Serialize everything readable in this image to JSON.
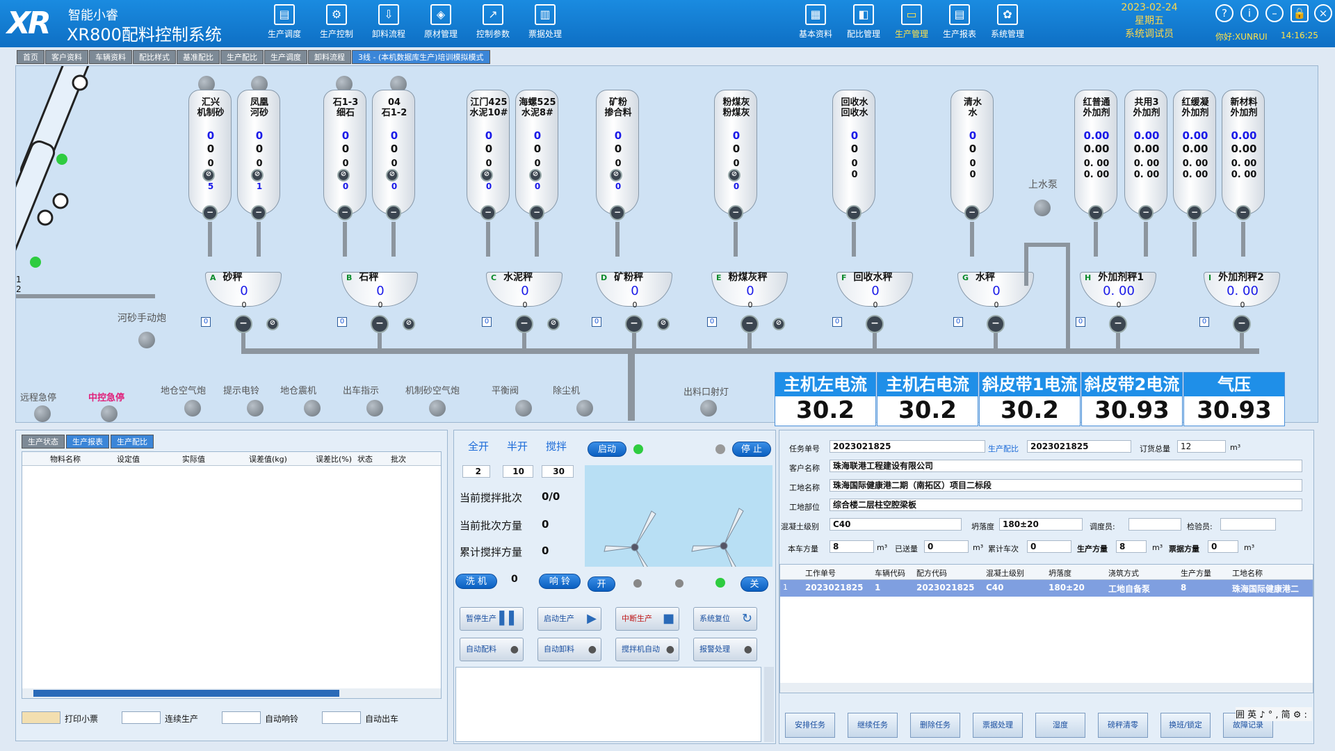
{
  "app": {
    "brand_cn": "智能小睿",
    "system_name": "XR800配料控制系统"
  },
  "topnav_left": [
    {
      "label": "生产调度",
      "icon": "schedule-icon"
    },
    {
      "label": "生产控制",
      "icon": "control-icon"
    },
    {
      "label": "卸料流程",
      "icon": "unload-icon"
    },
    {
      "label": "原材管理",
      "icon": "material-icon"
    },
    {
      "label": "控制参数",
      "icon": "chart-icon"
    },
    {
      "label": "票据处理",
      "icon": "ticket-icon"
    }
  ],
  "topnav_right": [
    {
      "label": "基本资料",
      "icon": "profile-icon"
    },
    {
      "label": "配比管理",
      "icon": "ratio-icon"
    },
    {
      "label": "生产管理",
      "icon": "monitor-icon",
      "active": true
    },
    {
      "label": "生产报表",
      "icon": "report-icon"
    },
    {
      "label": "系统管理",
      "icon": "gear-icon"
    }
  ],
  "date": "2023-02-24",
  "weekday": "星期五",
  "role": "系统调试员",
  "user": "你好:XUNRUI",
  "time": "14:16:25",
  "tabs": [
    "首页",
    "客户资料",
    "车辆资料",
    "配比样式",
    "基准配比",
    "生产配比",
    "生产调度",
    "卸料流程",
    "3线 - (本机数据库生产)培训模拟模式"
  ],
  "silos": [
    {
      "name": "汇兴\n机制砂",
      "v1": "0",
      "v2": "0",
      "v3": "0",
      "v4": "0",
      "v5": "5"
    },
    {
      "name": "凤凰\n河砂",
      "v1": "0",
      "v2": "0",
      "v3": "0",
      "v4": "0",
      "v5": "1"
    },
    {
      "name": "石1-3\n细石",
      "v1": "0",
      "v2": "0",
      "v3": "0",
      "v4": "0",
      "v5": "0"
    },
    {
      "name": "04\n石1-2",
      "v1": "0",
      "v2": "0",
      "v3": "0",
      "v4": "0",
      "v5": "0"
    },
    {
      "name": "江门425\n水泥10#",
      "v1": "0",
      "v2": "0",
      "v3": "0",
      "v4": "0",
      "v5": "0"
    },
    {
      "name": "海螺525\n水泥8#",
      "v1": "0",
      "v2": "0",
      "v3": "0",
      "v4": "0",
      "v5": "0"
    },
    {
      "name": "矿粉\n掺合料",
      "v1": "0",
      "v2": "0",
      "v3": "0",
      "v4": "0",
      "v5": "0"
    },
    {
      "name": "粉煤灰\n粉煤灰",
      "v1": "0",
      "v2": "0",
      "v3": "0",
      "v4": "0",
      "v5": "0"
    },
    {
      "name": "回收水\n回收水",
      "v1": "0",
      "v2": "0",
      "v3": "0",
      "v4": "0",
      "v5": ""
    },
    {
      "name": "清水\n水",
      "v1": "0",
      "v2": "0",
      "v3": "0",
      "v4": "0",
      "v5": ""
    },
    {
      "name": "红普通\n外加剂",
      "v1": "0.00",
      "v2": "0.00",
      "v3": "0. 00",
      "v4": "0. 00",
      "v5": ""
    },
    {
      "name": "共用3\n外加剂",
      "v1": "0.00",
      "v2": "0.00",
      "v3": "0. 00",
      "v4": "0. 00",
      "v5": ""
    },
    {
      "name": "红缓凝\n外加剂",
      "v1": "0.00",
      "v2": "0.00",
      "v3": "0. 00",
      "v4": "0. 00",
      "v5": ""
    },
    {
      "name": "新材料\n外加剂",
      "v1": "0.00",
      "v2": "0.00",
      "v3": "0. 00",
      "v4": "0. 00",
      "v5": ""
    }
  ],
  "hoppers": [
    {
      "letter": "A",
      "name": "砂秤",
      "value": "0",
      "sub": "0",
      "side": "0"
    },
    {
      "letter": "B",
      "name": "石秤",
      "value": "0",
      "sub": "0",
      "side": "0"
    },
    {
      "letter": "C",
      "name": "水泥秤",
      "value": "0",
      "sub": "0",
      "side": "0"
    },
    {
      "letter": "D",
      "name": "矿粉秤",
      "value": "0",
      "sub": "0",
      "side": "0"
    },
    {
      "letter": "E",
      "name": "粉煤灰秤",
      "value": "0",
      "sub": "0",
      "side": "0"
    },
    {
      "letter": "F",
      "name": "回收水秤",
      "value": "0",
      "sub": "0",
      "side": "0"
    },
    {
      "letter": "G",
      "name": "水秤",
      "value": "0",
      "sub": "0",
      "side": "0"
    },
    {
      "letter": "H",
      "name": "外加剂秤1",
      "value": "0. 00",
      "sub": "0",
      "side": "0"
    },
    {
      "letter": "I",
      "name": "外加剂秤2",
      "value": "0. 00",
      "sub": "0",
      "side": "0"
    }
  ],
  "conveyor": {
    "belt1": "1",
    "belt2": "2"
  },
  "labels": {
    "river_sand_cannon": "河砂手动炮",
    "water_pump": "上水泵",
    "remote_estop": "远程急停",
    "central_estop": "中控急停",
    "outlet_light": "出料口射灯"
  },
  "indicators": [
    "地仓空气炮",
    "提示电铃",
    "地仓震机",
    "出车指示",
    "机制砂空气炮",
    "平衡阀",
    "除尘机"
  ],
  "meters": [
    {
      "title": "主机左电流",
      "value": "30.2"
    },
    {
      "title": "主机右电流",
      "value": "30.2"
    },
    {
      "title": "斜皮带1电流",
      "value": "30.2"
    },
    {
      "title": "斜皮带2电流",
      "value": "30.93"
    },
    {
      "title": "气压",
      "value": "30.93"
    }
  ],
  "left_panel": {
    "tabs": [
      "生产状态",
      "生产报表",
      "生产配比"
    ],
    "columns": [
      "物料名称",
      "设定值",
      "实际值",
      "误差值(kg)",
      "误差比(%)",
      "状态",
      "批次"
    ],
    "checks": [
      "打印小票",
      "连续生产",
      "自动响铃",
      "自动出车"
    ]
  },
  "mix": {
    "open_full": "全开",
    "open_half": "半开",
    "stir": "搅拌",
    "full_val": "2",
    "half_val": "10",
    "stir_val": "30",
    "batch_label": "当前搅拌批次",
    "batch_value": "0/0",
    "volume_label": "当前批次方量",
    "volume_value": "0",
    "total_label": "累计搅拌方量",
    "total_value": "0",
    "wash": "洗 机",
    "wash_count": "0",
    "bell": "响 铃",
    "start": "启动",
    "stop": "停 止",
    "on": "开",
    "off": "关",
    "buttons": [
      "暂停生产",
      "启动生产",
      "中断生产",
      "系统复位",
      "自动配料",
      "自动卸料",
      "搅拌机自动",
      "报警处理"
    ]
  },
  "task": {
    "task_no_label": "任务单号",
    "task_no": "2023021825",
    "ratio_label": "生产配比",
    "ratio": "2023021825",
    "order_label": "订货总量",
    "order": "12",
    "order_unit": "m³",
    "customer_label": "客户名称",
    "customer": "珠海联港工程建设有限公司",
    "site_label": "工地名称",
    "site": "珠海国际健康港二期（南拓区）项目二标段",
    "part_label": "工地部位",
    "part": "综合楼二层柱空腔梁板",
    "grade_label": "混凝土级别",
    "grade": "C40",
    "slump_label": "坍落度",
    "slump": "180±20",
    "dispatcher_label": "调度员:",
    "inspector_label": "检验员:",
    "car_volume_label": "本车方量",
    "car_volume": "8",
    "unit": "m³",
    "sent_label": "已送量",
    "sent": "0",
    "trips_label": "累计车次",
    "trips": "0",
    "prod_volume_label": "生产方量",
    "prod_volume": "8",
    "ticket_volume_label": "票据方量",
    "ticket_volume": "0"
  },
  "task_grid": {
    "columns": [
      "工作单号",
      "车辆代码",
      "配方代码",
      "混凝土级别",
      "坍落度",
      "浇筑方式",
      "生产方量",
      "工地名称"
    ],
    "rows": [
      [
        "2023021825",
        "1",
        "2023021825",
        "C40",
        "180±20",
        "工地自备泵",
        "8",
        "珠海国际健康港二"
      ]
    ],
    "row_no": "1"
  },
  "bottom_buttons": [
    "安排任务",
    "继续任务",
    "删除任务",
    "票据处理",
    "湿度",
    "磅秤清零",
    "换班/锁定",
    "故障记录"
  ],
  "ime": "囲 英 ♪ ° , 简 ⚙ :"
}
